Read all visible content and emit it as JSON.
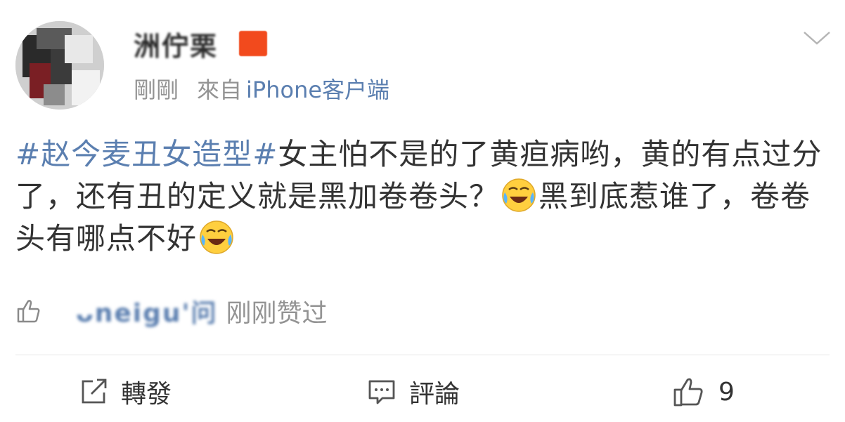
{
  "post": {
    "author_name": "洲佇栗",
    "time": "剛剛",
    "from_label": "來自",
    "source": "iPhone客户端",
    "topic": "#赵今麦丑女造型#",
    "text_part1": "女主怕不是的了黄疸病哟，黄的有点过分了，还有丑的定义就是黑加卷卷头？",
    "text_part2": "黑到底惹谁了，卷卷头有哪点不好",
    "emoji_name": "laugh-cry-emoji"
  },
  "liked": {
    "liker_name": "ᴗneigu'问",
    "liked_text": "刚刚赞过"
  },
  "actions": {
    "repost_label": "轉發",
    "comment_label": "評論",
    "like_count": "9"
  },
  "colors": {
    "link": "#5b7fb0",
    "meta": "#939393",
    "text": "#333333",
    "vip": "#f24a1d"
  }
}
